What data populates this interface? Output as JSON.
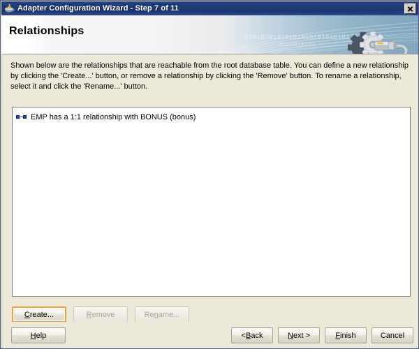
{
  "window": {
    "title": "Adapter Configuration Wizard - Step 7 of 11",
    "app_icon": "java-coffee-cup-icon",
    "close_label": "Close",
    "frame_color": "#4a5d8f",
    "titlebar_color": "#1d3a74",
    "background_color": "#ece9d8"
  },
  "banner": {
    "title": "Relationships",
    "binary_decoration_1": "01010101010101010101010101",
    "binary_decoration_2": "0101010101",
    "gear_icon": "gear-plug-icon",
    "accent_color": "#80a5bd"
  },
  "instructions": {
    "text": "Shown below are the relationships that are reachable from the root database table.  You can define a new relationship by clicking the 'Create...' button, or remove a relationship by clicking the 'Remove' button.  To rename a relationship, select it and click the 'Rename...' button."
  },
  "relationship_list": {
    "items": [
      {
        "icon": "relationship-link-icon",
        "label": "EMP has a 1:1 relationship with BONUS (bonus)",
        "selected": false
      }
    ]
  },
  "list_actions": {
    "create": {
      "label": "Create...",
      "mnemonic": "C",
      "enabled": true,
      "focused": true
    },
    "remove": {
      "label": "Remove",
      "mnemonic": "R",
      "enabled": false,
      "focused": false
    },
    "rename": {
      "label": "Rename...",
      "mnemonic": "n",
      "enabled": false,
      "focused": false
    }
  },
  "footer": {
    "help": {
      "label": "Help",
      "mnemonic": "H",
      "enabled": true
    },
    "back": {
      "label": "< Back",
      "mnemonic": "B",
      "enabled": true
    },
    "next": {
      "label": "Next >",
      "mnemonic": "N",
      "enabled": true
    },
    "finish": {
      "label": "Finish",
      "mnemonic": "F",
      "enabled": true
    },
    "cancel": {
      "label": "Cancel",
      "mnemonic": "",
      "enabled": true
    }
  },
  "focus_color": "#e8a33d"
}
